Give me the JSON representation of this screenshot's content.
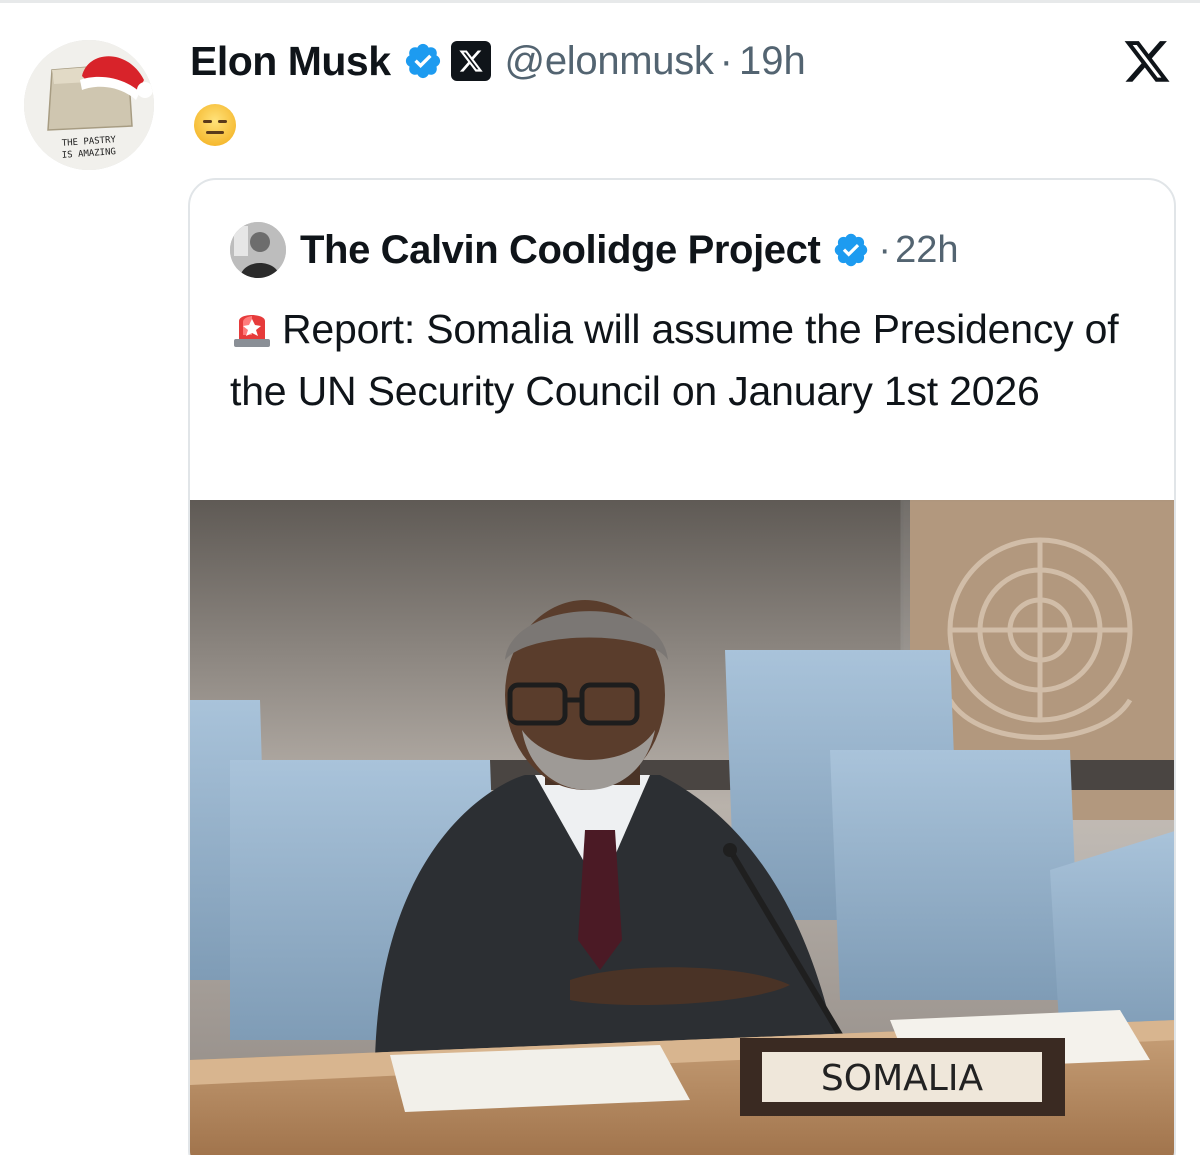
{
  "tweet": {
    "display_name": "Elon Musk",
    "handle": "@elonmusk",
    "separator": "·",
    "time": "19h",
    "body_emoji": "expressionless-face-emoji",
    "avatar_caption": "THE PASTRY IS AMAZING"
  },
  "quote": {
    "display_name": "The Calvin Coolidge Project",
    "separator": "·",
    "time": "22h",
    "text": "Report: Somalia will assume the Presidency of the UN Security Council on January 1st 2026",
    "leading_emoji": "police-siren-emoji",
    "image": {
      "nameplate": "SOMALIA"
    }
  },
  "icons": {
    "verified": "verified-badge-icon",
    "affiliate": "x-affiliate-badge-icon",
    "brand": "x-logo-icon"
  },
  "colors": {
    "verified_blue": "#1d9bf0",
    "text_primary": "#0f1419",
    "text_secondary": "#536471",
    "border": "#e1e5e8"
  }
}
